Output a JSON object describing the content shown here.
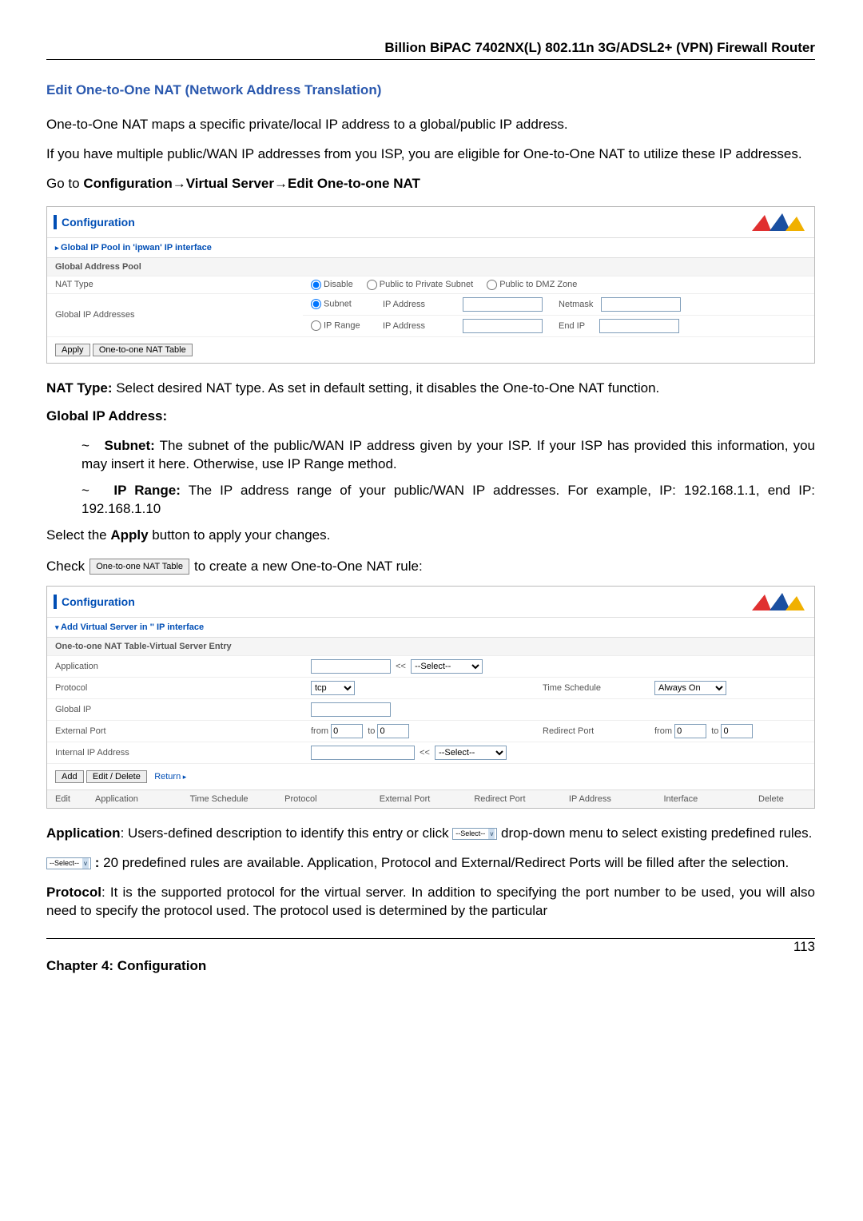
{
  "header": {
    "product": "Billion BiPAC 7402NX(L) 802.11n 3G/ADSL2+ (VPN) Firewall Router"
  },
  "section_title": "Edit One-to-One NAT (Network Address Translation)",
  "intro1": "One-to-One NAT maps a specific private/local IP address to a global/public IP address.",
  "intro2": "If you have multiple public/WAN IP addresses from you ISP, you are eligible for One-to-One NAT to utilize these IP addresses.",
  "nav": {
    "goto": "Go to ",
    "path_b": "Configuration→Virtual Server→Edit One-to-one NAT"
  },
  "panel1": {
    "title": "Configuration",
    "sub1": "Global IP Pool in 'ipwan' IP interface",
    "sub2": "Global Address Pool",
    "row1": {
      "label": "NAT Type",
      "opt1": "Disable",
      "opt2": "Public to Private Subnet",
      "opt3": "Public to DMZ Zone"
    },
    "row2": {
      "label": "Global IP Addresses",
      "subnet": "Subnet",
      "iprange": "IP Range",
      "ipaddr": "IP Address",
      "netmask": "Netmask",
      "endip": "End IP"
    },
    "btn_apply": "Apply",
    "btn_nat": "One-to-one NAT Table"
  },
  "nattype_line": {
    "lead": "NAT Type:",
    "rest": "   Select desired NAT type. As set in default setting, it disables the One-to-One NAT function."
  },
  "gip_head": "Global IP Address:",
  "bullet1": {
    "lead": "Subnet:",
    "rest": " The subnet of the public/WAN IP address given by your ISP.   If your ISP has provided this information, you may insert it here.   Otherwise, use IP Range method."
  },
  "bullet2": {
    "lead": "IP Range:",
    "rest": " The IP address range of your public/WAN IP addresses. For example, IP: 192.168.1.1, end IP: 192.168.1.10"
  },
  "apply_line": {
    "pre": "Select the ",
    "b": "Apply",
    "post": " button to apply your changes."
  },
  "check_line": {
    "pre": "Check ",
    "btn": "One-to-one NAT Table",
    "post": " to create a new One-to-One NAT rule:"
  },
  "panel2": {
    "title": "Configuration",
    "sub1": "Add Virtual Server in '' IP interface",
    "sub2": "One-to-one NAT Table-Virtual Server Entry",
    "app": "Application",
    "select_ph": "--Select--",
    "protocol": "Protocol",
    "proto_val": "tcp",
    "timesched": "Time Schedule",
    "timesched_val": "Always On",
    "globalip": "Global IP",
    "extport": "External Port",
    "redport": "Redirect Port",
    "from": "from",
    "to": "to",
    "zero": "0",
    "intip": "Internal IP Address",
    "btn_add": "Add",
    "btn_ed": "Edit / Delete",
    "return": "Return",
    "cols": {
      "c1": "Edit",
      "c2": "Application",
      "c3": "Time Schedule",
      "c4": "Protocol",
      "c5": "External Port",
      "c6": "Redirect Port",
      "c7": "IP Address",
      "c8": "Interface",
      "c9": "Delete"
    }
  },
  "app_desc": {
    "lead": "Application",
    "rest": ": Users-defined description to identify this entry or click ",
    "rest2": " drop-down menu to select existing predefined rules."
  },
  "sel_desc": {
    "lead": ":",
    "rest": " 20 predefined rules are available.   Application, Protocol and External/Redirect Ports will be filled after the selection."
  },
  "proto_desc": {
    "lead": "Protocol",
    "rest": ": It is the supported protocol for the virtual server. In addition to specifying the port number to be used, you will also need to specify the protocol used. The protocol used is determined by the particular"
  },
  "tiny_select": "--Select--",
  "page_num": "113",
  "chapter": "Chapter 4: Configuration"
}
